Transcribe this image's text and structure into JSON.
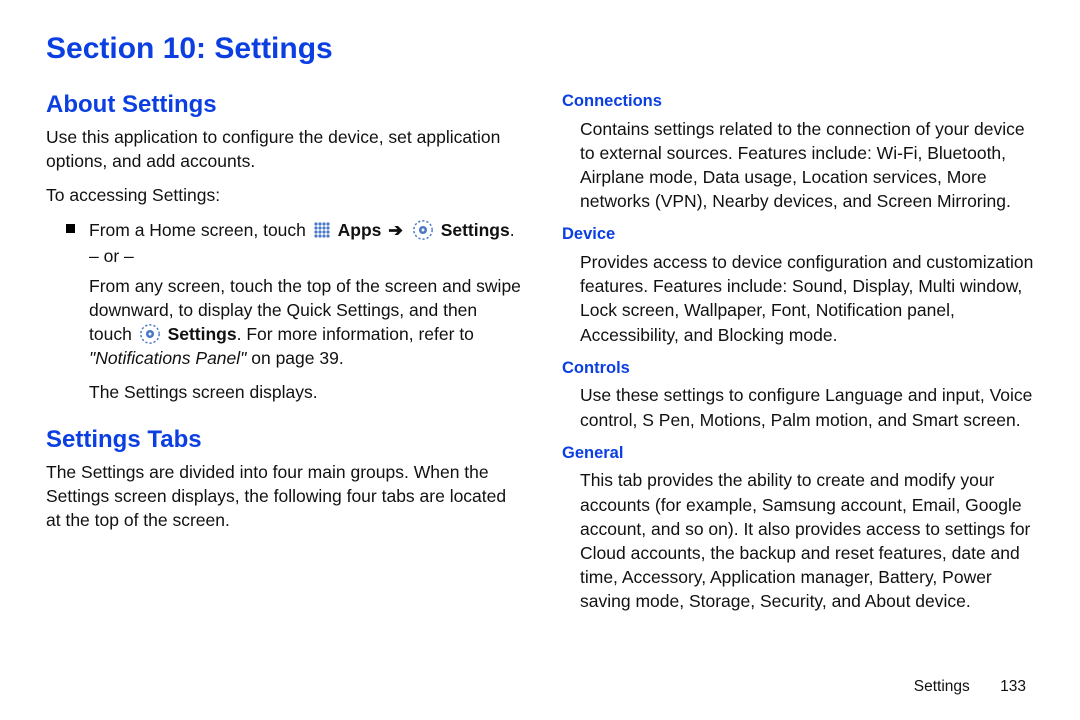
{
  "section_title": "Section 10: Settings",
  "about": {
    "heading": "About Settings",
    "intro": "Use this application to configure the device, set application options, and add accounts.",
    "access_label": "To accessing Settings:",
    "step_prefix": "From a Home screen, touch",
    "apps_bold": "Apps",
    "settings_bold": "Settings",
    "or_label": "– or –",
    "quick_before": "From any screen, touch the top of the screen and swipe downward, to display the Quick Settings, and then touch",
    "quick_bold": "Settings",
    "quick_after": ". For more information, refer to ",
    "xref_ital": "\"Notifications Panel\"",
    "xref_page": " on page 39.",
    "result": "The Settings screen displays."
  },
  "tabs": {
    "heading": "Settings Tabs",
    "intro": "The Settings are divided into four main groups. When the Settings screen displays, the following four tabs are located at the top of the screen."
  },
  "connections": {
    "heading": "Connections",
    "body": "Contains settings related to the connection of your device to external sources. Features include: Wi-Fi, Bluetooth, Airplane mode, Data usage, Location services, More networks (VPN), Nearby devices, and Screen Mirroring."
  },
  "device": {
    "heading": "Device",
    "body": "Provides access to device configuration and customization features. Features include: Sound, Display, Multi window, Lock screen, Wallpaper, Font, Notification panel, Accessibility, and Blocking mode."
  },
  "controls": {
    "heading": "Controls",
    "body": "Use these settings to configure Language and input, Voice control, S Pen, Motions, Palm motion, and Smart screen."
  },
  "general": {
    "heading": "General",
    "body": "This tab provides the ability to create and modify your accounts (for example, Samsung account, Email, Google account, and so on). It also provides access to settings for Cloud accounts, the backup and reset features, date and time, Accessory, Application manager, Battery, Power saving mode, Storage, Security, and About device."
  },
  "footer": {
    "name": "Settings",
    "page": "133"
  },
  "icons": {
    "apps_name": "apps-grid-icon",
    "gear_name": "settings-gear-icon",
    "arrow_name": "arrow-icon"
  }
}
